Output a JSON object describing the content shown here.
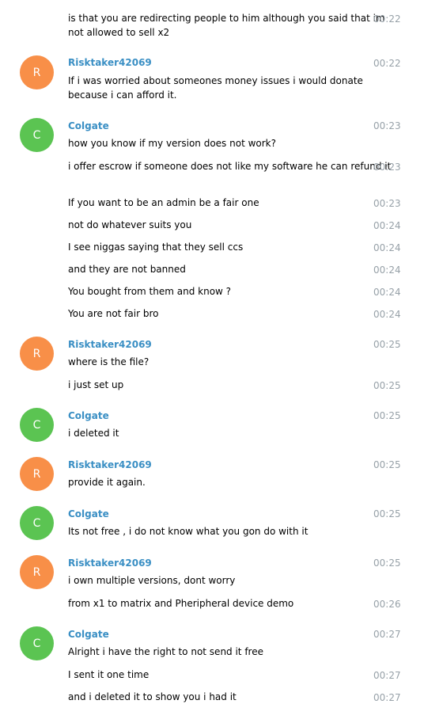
{
  "colors": {
    "sender_name": "#3a8fc4",
    "timestamp": "#97a1a8",
    "avatar_R": "#f88f48",
    "avatar_C": "#5bc452",
    "avatar_text": "#ffffff"
  },
  "messages": [
    {
      "text": "is that you are redirecting people to him although you said that im not allowed to sell x2",
      "time": "00:22"
    },
    {
      "sender": "Risktaker42069",
      "initial": "R",
      "text": "If i was worried about someones money issues i would donate because i can afford it.",
      "time": "00:22"
    },
    {
      "sender": "Colgate",
      "initial": "C",
      "text": "how you know if my version does not work?",
      "time": "00:23"
    },
    {
      "text": "i offer escrow if someone does not like my software he can refund it",
      "time": "00:23"
    },
    {
      "text": "If you want to be an admin be a fair one",
      "time": "00:23"
    },
    {
      "text": "not do whatever suits you",
      "time": "00:24"
    },
    {
      "text": "I see niggas saying that they sell ccs",
      "time": "00:24"
    },
    {
      "text": "and they are not banned",
      "time": "00:24"
    },
    {
      "text": "You bought from them and know ?",
      "time": "00:24"
    },
    {
      "text": "You are not fair bro",
      "time": "00:24"
    },
    {
      "sender": "Risktaker42069",
      "initial": "R",
      "text": "where is the file?",
      "time": "00:25"
    },
    {
      "text": "i just set up",
      "time": "00:25"
    },
    {
      "sender": "Colgate",
      "initial": "C",
      "text": "i deleted it",
      "time": "00:25"
    },
    {
      "sender": "Risktaker42069",
      "initial": "R",
      "text": "provide it again.",
      "time": "00:25"
    },
    {
      "sender": "Colgate",
      "initial": "C",
      "text": "Its not free , i do not know what you gon do with it",
      "time": "00:25"
    },
    {
      "sender": "Risktaker42069",
      "initial": "R",
      "text": "i own multiple versions, dont worry",
      "time": "00:25"
    },
    {
      "text": "from x1 to matrix and Pheripheral device demo",
      "time": "00:26"
    },
    {
      "sender": "Colgate",
      "initial": "C",
      "text": "Alright i have the right to not send it free",
      "time": "00:27"
    },
    {
      "text": "I sent it one time",
      "time": "00:27"
    },
    {
      "text": "and i deleted it to show you i had it",
      "time": "00:27"
    }
  ]
}
